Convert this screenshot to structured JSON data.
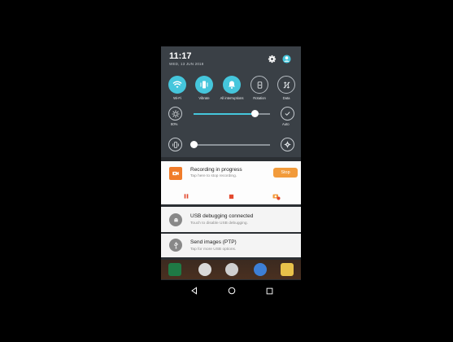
{
  "status": {
    "time": "11:17",
    "date": "WED, 13 JUN 2018"
  },
  "quick_settings": {
    "tiles": [
      {
        "label": "Wi-Fi",
        "icon": "wifi-icon",
        "state": "on"
      },
      {
        "label": "Vibrate",
        "icon": "vibrate-icon",
        "state": "on"
      },
      {
        "label": "All interruptions",
        "icon": "bell-icon",
        "state": "on"
      },
      {
        "label": "Rotation",
        "icon": "rotation-icon",
        "state": "off"
      },
      {
        "label": "Data",
        "icon": "data-icon",
        "state": "off"
      }
    ],
    "brightness": {
      "label": "80%",
      "level": 0.8,
      "right_label": "Auto"
    },
    "volume": {
      "level": 0.0
    }
  },
  "notifications": {
    "recording": {
      "title": "Recording in progress",
      "subtitle": "Tap here to stop recording.",
      "button": "Stop"
    },
    "usb": {
      "title": "USB debugging connected",
      "subtitle": "Touch to disable USB debugging."
    },
    "ptp": {
      "title": "Send images (PTP)",
      "subtitle": "Tap for more USB options."
    }
  },
  "colors": {
    "accent": "#45c6dc",
    "record": "#f07c2a",
    "stop": "#f29b3b"
  }
}
